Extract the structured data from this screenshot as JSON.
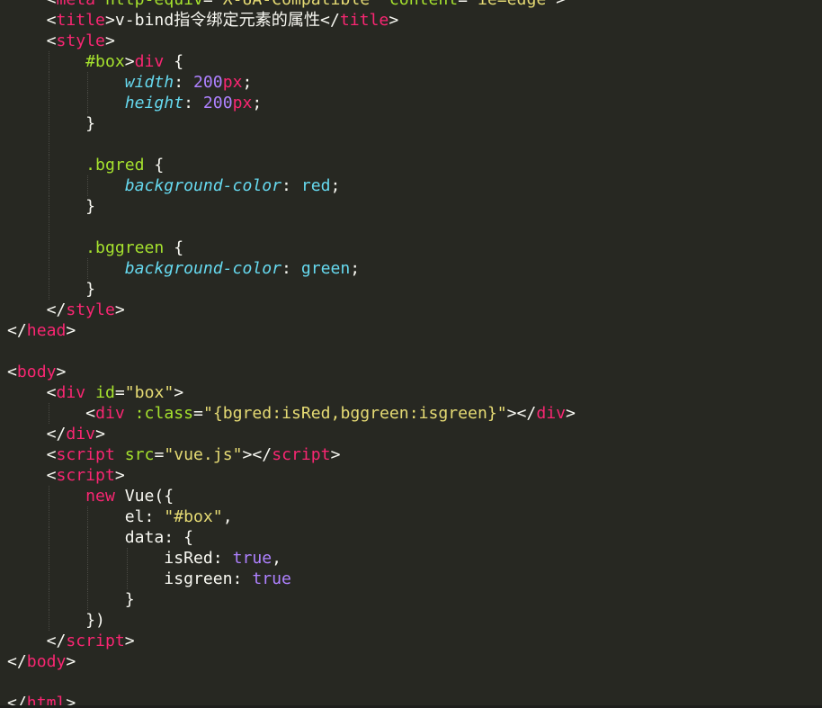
{
  "editor": {
    "theme_colors": {
      "background": "#272822",
      "tag": "#f92672",
      "attribute": "#a6e22e",
      "string": "#e6db74",
      "property": "#66d9ef",
      "number": "#ae81ff",
      "text": "#f8f8f2"
    },
    "lines": [
      {
        "indent": 1,
        "tokens": [
          [
            "w",
            "<"
          ],
          [
            "t",
            "meta"
          ],
          [
            "w",
            " "
          ],
          [
            "a",
            "http-equiv"
          ],
          [
            "w",
            "="
          ],
          [
            "s",
            "\"X-UA-Compatible\""
          ],
          [
            "w",
            " "
          ],
          [
            "a",
            "content"
          ],
          [
            "w",
            "="
          ],
          [
            "s",
            "\"ie=edge\""
          ],
          [
            "w",
            ">"
          ]
        ]
      },
      {
        "indent": 1,
        "tokens": [
          [
            "w",
            "<"
          ],
          [
            "t",
            "title"
          ],
          [
            "w",
            ">v-bind指令绑定元素的属性</"
          ],
          [
            "t",
            "title"
          ],
          [
            "w",
            ">"
          ]
        ]
      },
      {
        "indent": 1,
        "tokens": [
          [
            "w",
            "<"
          ],
          [
            "t",
            "style"
          ],
          [
            "w",
            ">"
          ]
        ]
      },
      {
        "indent": 2,
        "tokens": [
          [
            "a",
            "#box"
          ],
          [
            "w",
            ">"
          ],
          [
            "t",
            "div"
          ],
          [
            "w",
            " {"
          ]
        ]
      },
      {
        "indent": 3,
        "tokens": [
          [
            "p",
            "width"
          ],
          [
            "w",
            ": "
          ],
          [
            "n",
            "200"
          ],
          [
            "u",
            "px"
          ],
          [
            "w",
            ";"
          ]
        ]
      },
      {
        "indent": 3,
        "tokens": [
          [
            "p",
            "height"
          ],
          [
            "w",
            ": "
          ],
          [
            "n",
            "200"
          ],
          [
            "u",
            "px"
          ],
          [
            "w",
            ";"
          ]
        ]
      },
      {
        "indent": 2,
        "tokens": [
          [
            "w",
            "}"
          ]
        ]
      },
      {
        "indent": 2,
        "tokens": []
      },
      {
        "indent": 2,
        "tokens": [
          [
            "c",
            ".bgred"
          ],
          [
            "w",
            " {"
          ]
        ]
      },
      {
        "indent": 3,
        "tokens": [
          [
            "p",
            "background-color"
          ],
          [
            "w",
            ": "
          ],
          [
            "v",
            "red"
          ],
          [
            "w",
            ";"
          ]
        ]
      },
      {
        "indent": 2,
        "tokens": [
          [
            "w",
            "}"
          ]
        ]
      },
      {
        "indent": 2,
        "tokens": []
      },
      {
        "indent": 2,
        "tokens": [
          [
            "c",
            ".bggreen"
          ],
          [
            "w",
            " {"
          ]
        ]
      },
      {
        "indent": 3,
        "tokens": [
          [
            "p",
            "background-color"
          ],
          [
            "w",
            ": "
          ],
          [
            "v",
            "green"
          ],
          [
            "w",
            ";"
          ]
        ]
      },
      {
        "indent": 2,
        "tokens": [
          [
            "w",
            "}"
          ]
        ]
      },
      {
        "indent": 1,
        "tokens": [
          [
            "w",
            "</"
          ],
          [
            "t",
            "style"
          ],
          [
            "w",
            ">"
          ]
        ]
      },
      {
        "indent": 0,
        "tokens": [
          [
            "w",
            "</"
          ],
          [
            "t",
            "head"
          ],
          [
            "w",
            ">"
          ]
        ]
      },
      {
        "indent": 0,
        "tokens": []
      },
      {
        "indent": 0,
        "tokens": [
          [
            "w",
            "<"
          ],
          [
            "t",
            "body"
          ],
          [
            "w",
            ">"
          ]
        ]
      },
      {
        "indent": 1,
        "tokens": [
          [
            "w",
            "<"
          ],
          [
            "t",
            "div"
          ],
          [
            "w",
            " "
          ],
          [
            "a",
            "id"
          ],
          [
            "w",
            "="
          ],
          [
            "s",
            "\"box\""
          ],
          [
            "w",
            ">"
          ]
        ]
      },
      {
        "indent": 2,
        "tokens": [
          [
            "w",
            "<"
          ],
          [
            "t",
            "div"
          ],
          [
            "w",
            " "
          ],
          [
            "a",
            ":class"
          ],
          [
            "w",
            "="
          ],
          [
            "s",
            "\"{bgred:isRed,bggreen:isgreen}\""
          ],
          [
            "w",
            "></"
          ],
          [
            "t",
            "div"
          ],
          [
            "w",
            ">"
          ]
        ]
      },
      {
        "indent": 1,
        "tokens": [
          [
            "w",
            "</"
          ],
          [
            "t",
            "div"
          ],
          [
            "w",
            ">"
          ]
        ]
      },
      {
        "indent": 1,
        "tokens": [
          [
            "w",
            "<"
          ],
          [
            "t",
            "script"
          ],
          [
            "w",
            " "
          ],
          [
            "a",
            "src"
          ],
          [
            "w",
            "="
          ],
          [
            "s",
            "\"vue.js\""
          ],
          [
            "w",
            "></"
          ],
          [
            "t",
            "script"
          ],
          [
            "w",
            ">"
          ]
        ]
      },
      {
        "indent": 1,
        "tokens": [
          [
            "w",
            "<"
          ],
          [
            "t",
            "script"
          ],
          [
            "w",
            ">"
          ]
        ]
      },
      {
        "indent": 2,
        "tokens": [
          [
            "k",
            "new"
          ],
          [
            "w",
            " Vue({"
          ]
        ]
      },
      {
        "indent": 3,
        "tokens": [
          [
            "w",
            "el: "
          ],
          [
            "s",
            "\"#box\""
          ],
          [
            "w",
            ","
          ]
        ]
      },
      {
        "indent": 3,
        "tokens": [
          [
            "w",
            "data: {"
          ]
        ]
      },
      {
        "indent": 4,
        "tokens": [
          [
            "w",
            "isRed: "
          ],
          [
            "n",
            "true"
          ],
          [
            "w",
            ","
          ]
        ]
      },
      {
        "indent": 4,
        "tokens": [
          [
            "w",
            "isgreen: "
          ],
          [
            "n",
            "true"
          ]
        ]
      },
      {
        "indent": 3,
        "tokens": [
          [
            "w",
            "}"
          ]
        ]
      },
      {
        "indent": 2,
        "tokens": [
          [
            "w",
            "})"
          ]
        ]
      },
      {
        "indent": 1,
        "tokens": [
          [
            "w",
            "</"
          ],
          [
            "t",
            "script"
          ],
          [
            "w",
            ">"
          ]
        ]
      },
      {
        "indent": 0,
        "tokens": [
          [
            "w",
            "</"
          ],
          [
            "t",
            "body"
          ],
          [
            "w",
            ">"
          ]
        ]
      },
      {
        "indent": 0,
        "tokens": []
      },
      {
        "indent": 0,
        "tokens": [
          [
            "w",
            "</"
          ],
          [
            "t",
            "html"
          ],
          [
            "w",
            ">"
          ]
        ]
      }
    ]
  }
}
